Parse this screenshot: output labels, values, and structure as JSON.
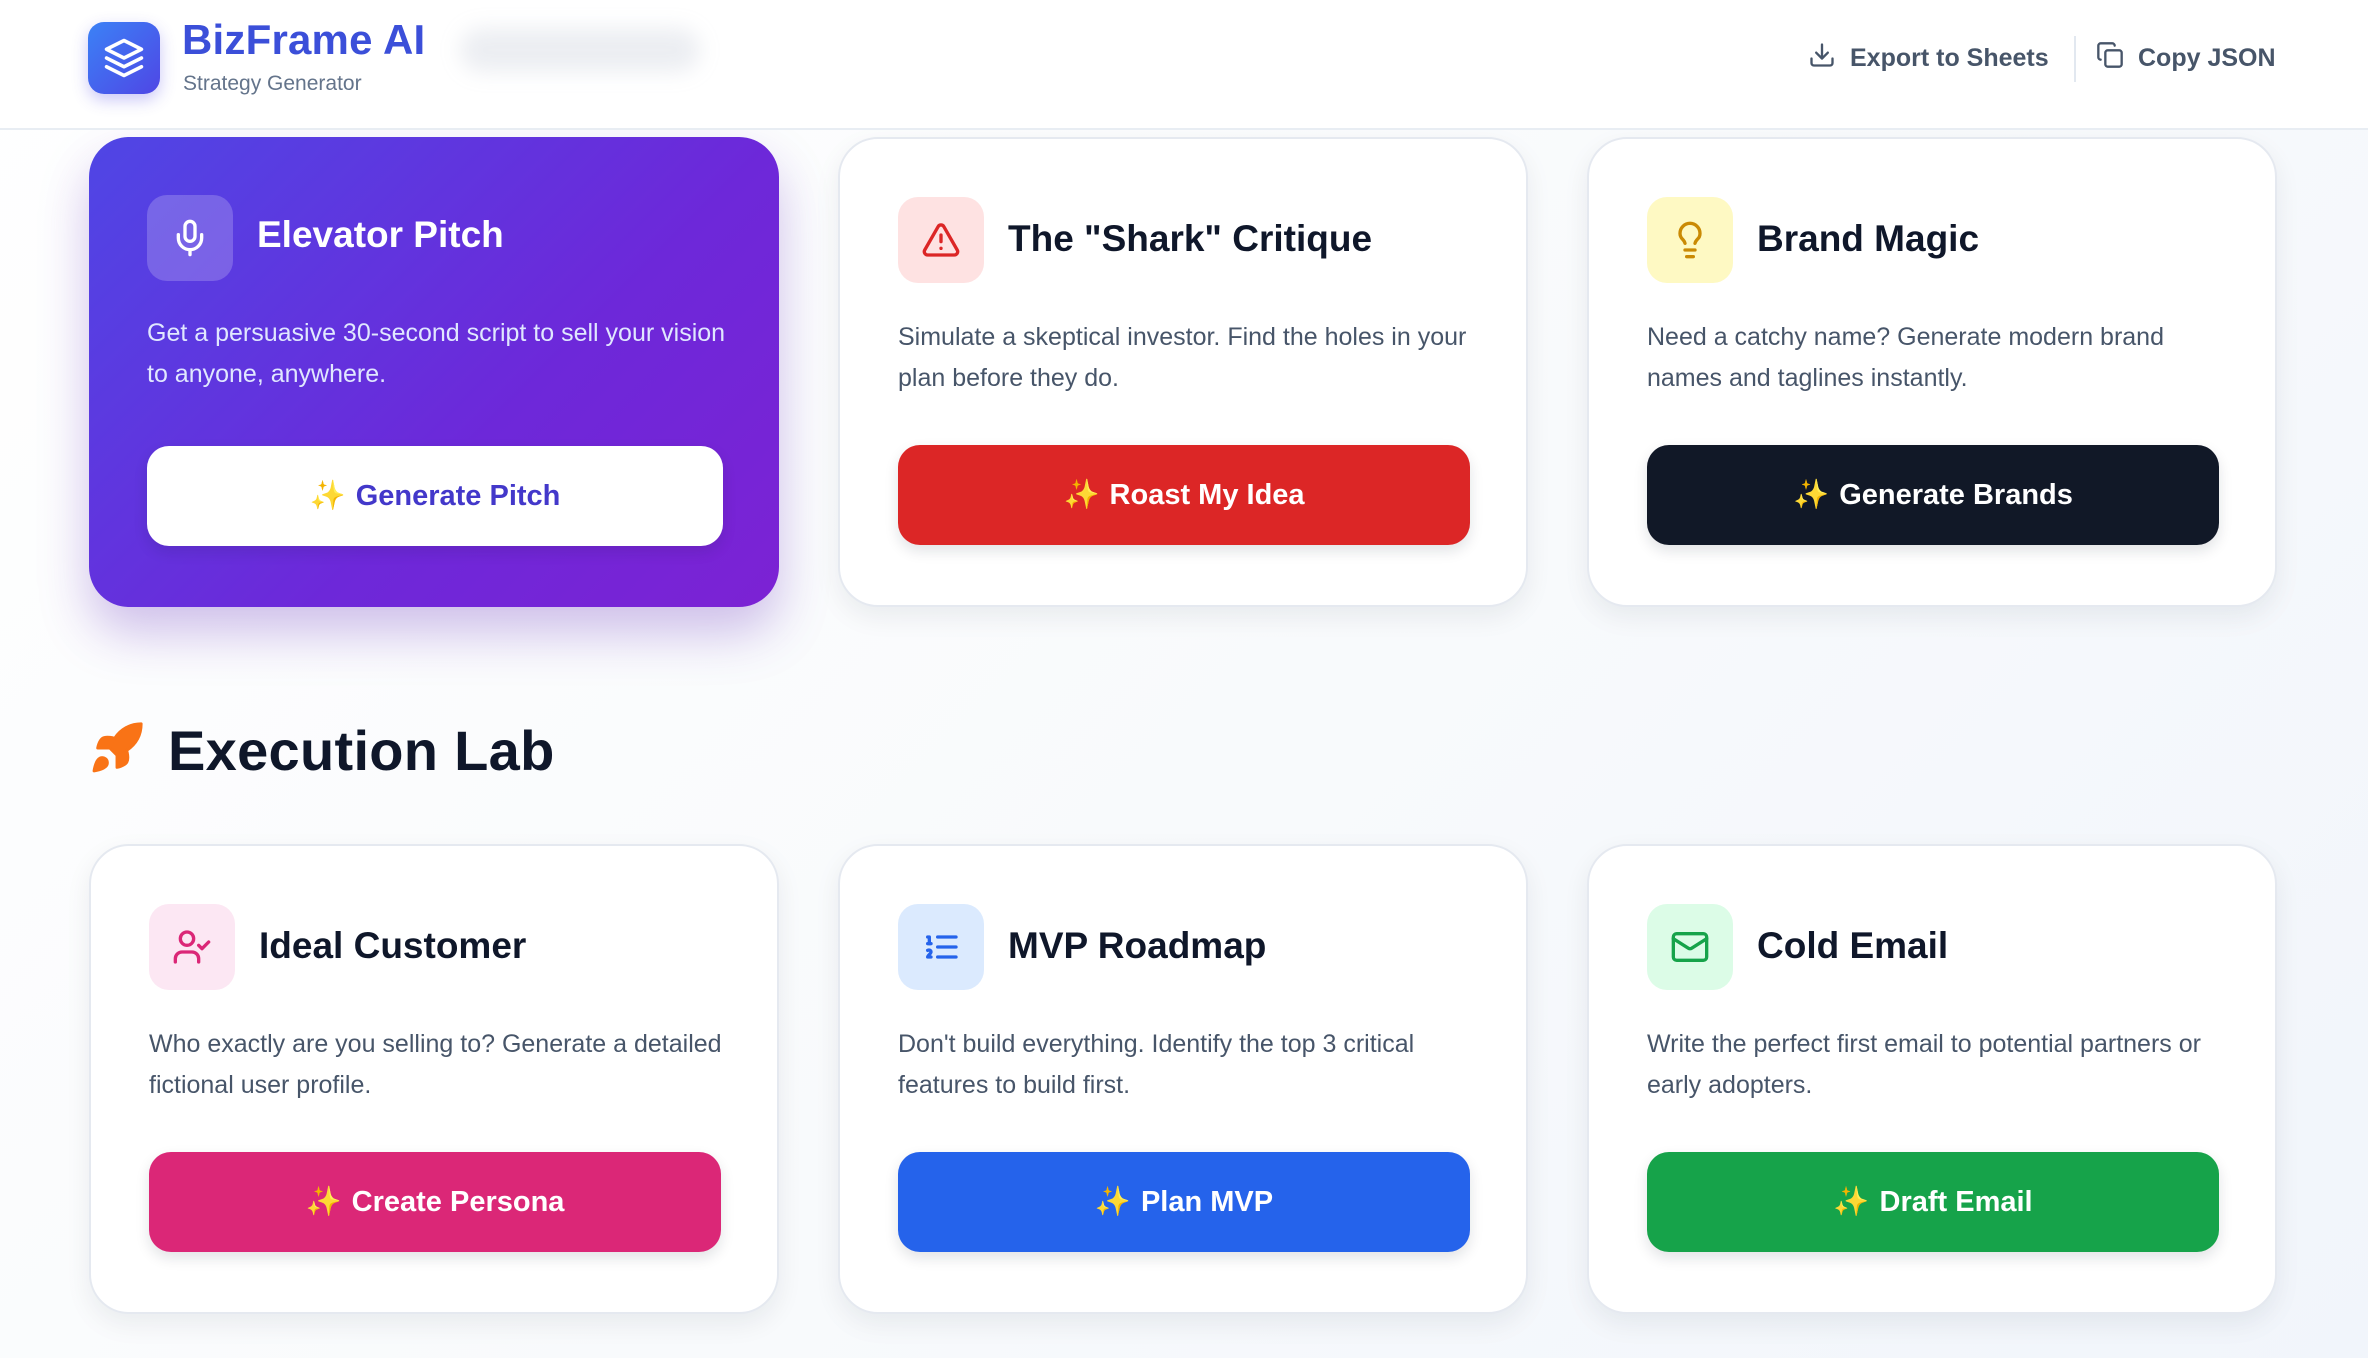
{
  "header": {
    "title": "BizFrame AI",
    "subtitle": "Strategy Generator",
    "export_label": "Export to Sheets",
    "copy_label": "Copy JSON"
  },
  "top_cards": [
    {
      "title": "Elevator Pitch",
      "description": "Get a persuasive 30-second script to sell your vision to anyone, anywhere.",
      "button": "Generate Pitch",
      "icon": "microphone-icon"
    },
    {
      "title": "The \"Shark\" Critique",
      "description": "Simulate a skeptical investor. Find the holes in your plan before they do.",
      "button": "Roast My Idea",
      "icon": "warning-triangle-icon"
    },
    {
      "title": "Brand Magic",
      "description": "Need a catchy name? Generate modern brand names and taglines instantly.",
      "button": "Generate Brands",
      "icon": "lightbulb-icon"
    }
  ],
  "execution_lab": {
    "title": "Execution Lab",
    "icon": "rocket-icon",
    "cards": [
      {
        "title": "Ideal Customer",
        "description": "Who exactly are you selling to? Generate a detailed fictional user profile.",
        "button": "Create Persona",
        "icon": "user-check-icon"
      },
      {
        "title": "MVP Roadmap",
        "description": "Don't build everything. Identify the top 3 critical features to build first.",
        "button": "Plan MVP",
        "icon": "list-ordered-icon"
      },
      {
        "title": "Cold Email",
        "description": "Write the perfect first email to potential partners or early adopters.",
        "button": "Draft Email",
        "icon": "mail-icon"
      }
    ]
  },
  "colors": {
    "brand": "#3b4fd9",
    "featured_gradient": [
      "#4f46e5",
      "#7c22d4"
    ],
    "red": "#dc2626",
    "dark": "#111827",
    "pink": "#db2777",
    "blue": "#2563eb",
    "green": "#16a34a"
  }
}
